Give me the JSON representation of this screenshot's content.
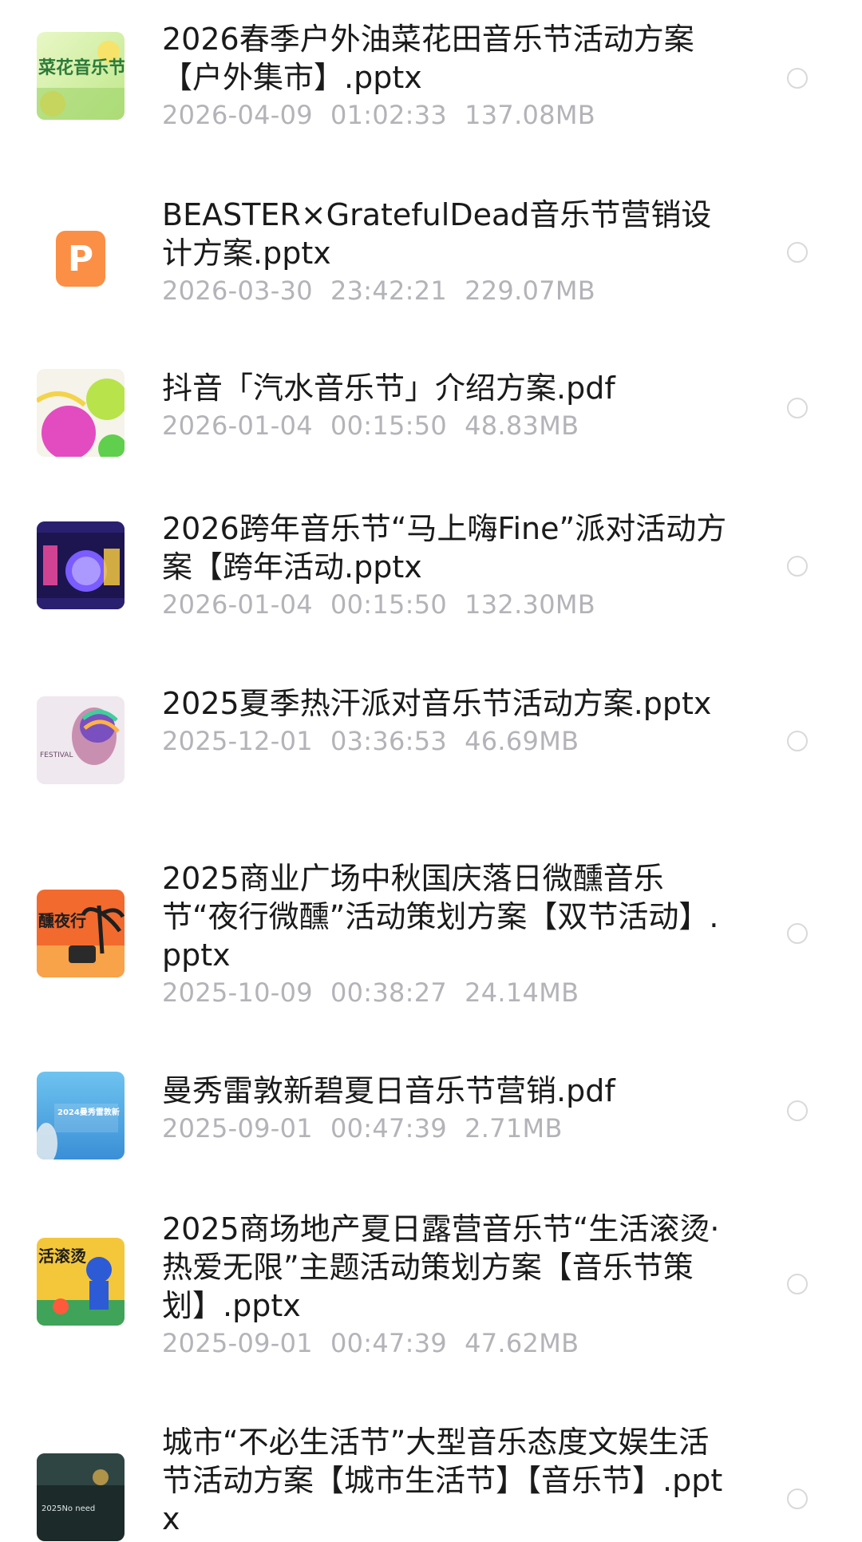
{
  "files": [
    {
      "name": "2026春季户外油菜花田音乐节活动方案【户外集市】.pptx",
      "date": "2026-04-09",
      "time": "01:02:33",
      "size": "137.08MB",
      "thumb_label": "菜花音乐节"
    },
    {
      "name": "BEASTER×GratefulDead音乐节营销设计方案.pptx",
      "date": "2026-03-30",
      "time": "23:42:21",
      "size": "229.07MB",
      "thumb_label": "P"
    },
    {
      "name": "抖音「汽水音乐节」介绍方案.pdf",
      "date": "2026-01-04",
      "time": "00:15:50",
      "size": "48.83MB",
      "thumb_label": ""
    },
    {
      "name": "2026跨年音乐节“马上嗨Fine”派对活动方案【跨年活动.pptx",
      "date": "2026-01-04",
      "time": "00:15:50",
      "size": "132.30MB",
      "thumb_label": ""
    },
    {
      "name": "2025夏季热汗派对音乐节活动方案.pptx",
      "date": "2025-12-01",
      "time": "03:36:53",
      "size": "46.69MB",
      "thumb_label": "FESTIVAL"
    },
    {
      "name": "2025商业广场中秋国庆落日微醺音乐节“夜行微醺”活动策划方案【双节活动】.pptx",
      "date": "2025-10-09",
      "time": "00:38:27",
      "size": "24.14MB",
      "thumb_label": "醺夜行"
    },
    {
      "name": "曼秀雷敦新碧夏日音乐节营销.pdf",
      "date": "2025-09-01",
      "time": "00:47:39",
      "size": "2.71MB",
      "thumb_label": "2024曼秀雷敦新"
    },
    {
      "name": "2025商场地产夏日露营音乐节“生活滚烫·热爱无限”主题活动策划方案【音乐节策划】.pptx",
      "date": "2025-09-01",
      "time": "00:47:39",
      "size": "47.62MB",
      "thumb_label": "活滚烫"
    },
    {
      "name": "城市“不必生活节”大型音乐态度文娱生活节活动方案【城市生活节】【音乐节】.pptx",
      "date": "",
      "time": "",
      "size": "",
      "thumb_label": "2025No need"
    }
  ]
}
